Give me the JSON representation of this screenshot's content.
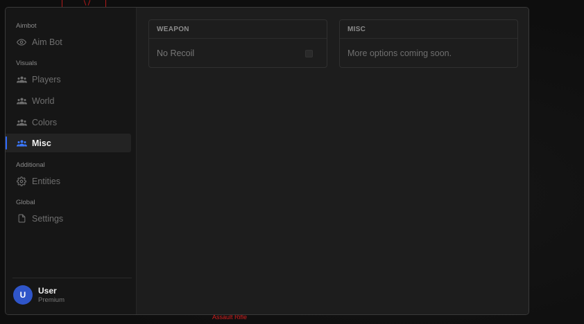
{
  "sidebar": {
    "sections": [
      {
        "label": "Aimbot"
      },
      {
        "label": "Visuals"
      },
      {
        "label": "Additional"
      },
      {
        "label": "Global"
      }
    ],
    "items": [
      {
        "label": "Aim Bot",
        "icon": "eye-icon"
      },
      {
        "label": "Players",
        "icon": "users-icon"
      },
      {
        "label": "World",
        "icon": "users-icon"
      },
      {
        "label": "Colors",
        "icon": "users-icon"
      },
      {
        "label": "Misc",
        "icon": "users-icon",
        "active": true
      },
      {
        "label": "Entities",
        "icon": "gear-icon"
      },
      {
        "label": "Settings",
        "icon": "file-icon"
      }
    ],
    "user": {
      "initial": "U",
      "name": "User",
      "tier": "Premium"
    }
  },
  "main": {
    "cards": [
      {
        "title": "WEAPON",
        "rows": [
          {
            "label": "No Recoil",
            "checked": false
          }
        ]
      },
      {
        "title": "MISC",
        "note": "More options coming soon."
      }
    ]
  },
  "overlay": {
    "esp_label": "Assault Rifle"
  },
  "colors": {
    "accent": "#2f6bff",
    "avatar": "#2f55c9",
    "esp": "#d21f1f"
  }
}
